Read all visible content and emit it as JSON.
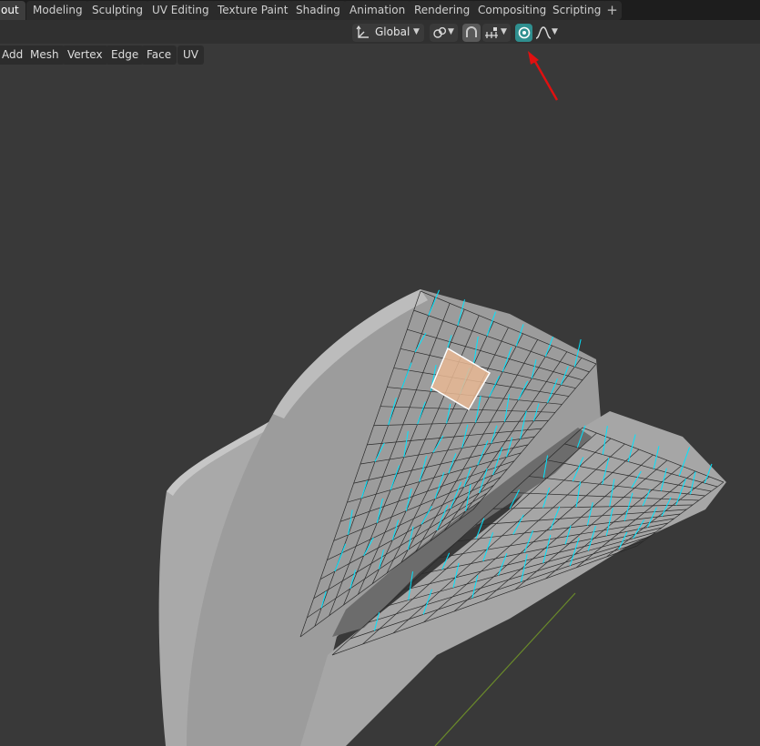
{
  "workspace_tabs": [
    {
      "label": "out",
      "active": true
    },
    {
      "label": "Modeling"
    },
    {
      "label": "Sculpting"
    },
    {
      "label": "UV Editing"
    },
    {
      "label": "Texture Paint"
    },
    {
      "label": "Shading"
    },
    {
      "label": "Animation"
    },
    {
      "label": "Rendering"
    },
    {
      "label": "Compositing"
    },
    {
      "label": "Scripting"
    }
  ],
  "add_workspace": "+",
  "header": {
    "transform_orientation": "Global",
    "proportional_editing": true,
    "proportional_falloff_icon": "smooth-curve-icon",
    "snap_icon": "magnet-icon",
    "pivot_icon": "chain-link-icon",
    "orientation_icon": "axes-icon",
    "increment_icon": "snap-increment-icon"
  },
  "edit_menu": [
    "Add",
    "Mesh",
    "Vertex",
    "Edge",
    "Face",
    "UV"
  ],
  "colors": {
    "accent": "#2f8f8f",
    "normals": "#00e5ff",
    "selected_face": "#ffa060",
    "arrow": "#e01010",
    "viewport_bg": "#393939"
  }
}
